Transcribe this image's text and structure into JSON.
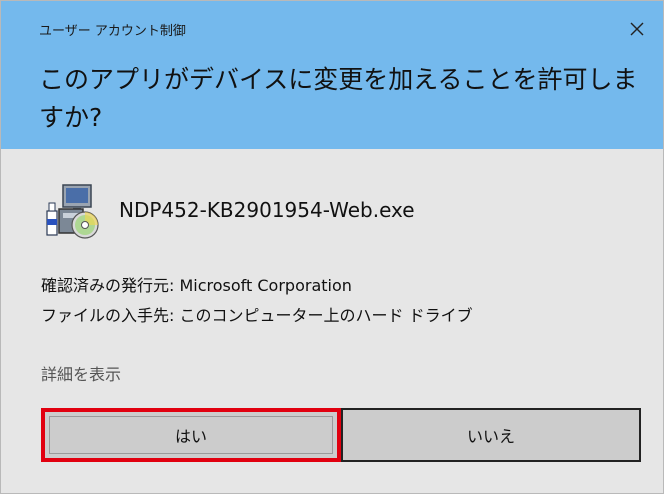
{
  "window": {
    "title": "ユーザー アカウント制御",
    "close_label": "✕"
  },
  "header": {
    "prompt": "このアプリがデバイスに変更を加えることを許可しますか?"
  },
  "program": {
    "icon": "installer-package-icon",
    "file_name": "NDP452-KB2901954-Web.exe"
  },
  "info": {
    "publisher": "確認済みの発行元: Microsoft Corporation",
    "origin": "ファイルの入手先: このコンピューター上のハード ドライブ"
  },
  "details_link": "詳細を表示",
  "buttons": {
    "yes": "はい",
    "no": "いいえ"
  },
  "colors": {
    "header_bg": "#74b9ed",
    "body_bg": "#e6e6e6",
    "highlight": "#e1000f"
  }
}
